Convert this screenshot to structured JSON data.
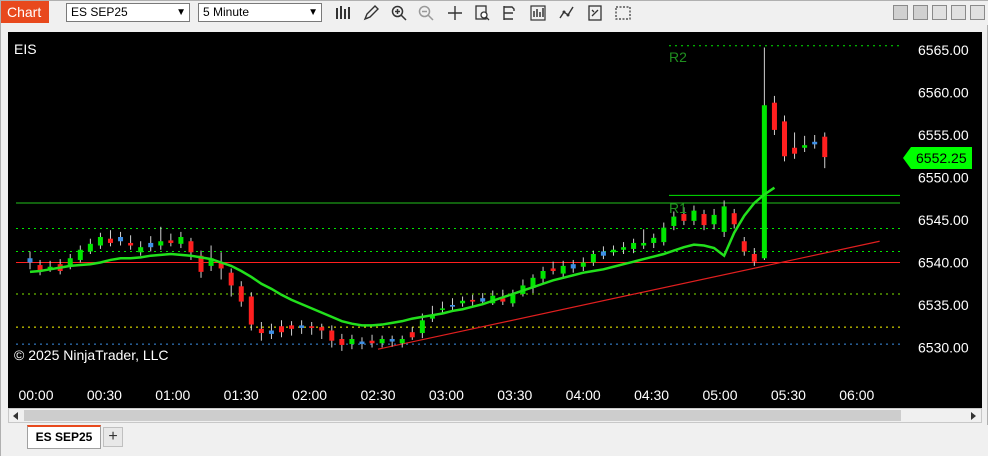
{
  "window": {
    "badge": "Chart"
  },
  "toolbar": {
    "instrument": "ES SEP25",
    "interval": "5 Minute",
    "icons": [
      "bar-style-icon",
      "pencil-icon",
      "zoom-in-icon",
      "zoom-out-icon",
      "crosshair-icon",
      "properties-icon",
      "data-box-icon",
      "indicators-icon",
      "strategies-icon",
      "templates-icon",
      "chart-trader-icon"
    ],
    "window_icons": [
      "pin-icon",
      "minimize-icon",
      "maximize-icon",
      "close-icon"
    ]
  },
  "chart": {
    "instrument_label": "EIS",
    "copyright": "© 2025 NinjaTrader, LLC",
    "price_marker": "6552.25",
    "level_labels": {
      "r2": "R2",
      "r1": "R1"
    },
    "y_ticks": [
      "6565.00",
      "6560.00",
      "6555.00",
      "6550.00",
      "6545.00",
      "6540.00",
      "6535.00",
      "6530.00"
    ],
    "x_ticks": [
      "00:00",
      "00:30",
      "01:00",
      "01:30",
      "02:00",
      "02:30",
      "03:00",
      "03:30",
      "04:00",
      "04:30",
      "05:00",
      "05:30",
      "06:00"
    ],
    "colors": {
      "up": "#00e600",
      "down": "#ff1f1f",
      "neutral": "#3d8fe6",
      "ma": "#22e01c",
      "trend": "#e01f1f"
    }
  },
  "chart_data": {
    "type": "candlestick",
    "ylim": [
      6528.5,
      6567.5
    ],
    "x_range": [
      "00:00",
      "06:00"
    ],
    "levels": [
      {
        "name": "R2",
        "value": 6565.5,
        "style": "dotted",
        "color": "#00e600"
      },
      {
        "name": "R1",
        "value": 6547.9,
        "style": "solid",
        "color": "#00e600"
      },
      {
        "value": 6547.0,
        "style": "solid",
        "color": "#22c01c"
      },
      {
        "value": 6544.0,
        "style": "dotted",
        "color": "#00e600"
      },
      {
        "value": 6541.3,
        "style": "dotted",
        "color": "#00e600"
      },
      {
        "value": 6540.0,
        "style": "solid",
        "color": "#ff1f1f"
      },
      {
        "value": 6536.3,
        "style": "dotted",
        "color": "#80e600"
      },
      {
        "value": 6532.4,
        "style": "dotted",
        "color": "#ffff00"
      },
      {
        "value": 6530.4,
        "style": "dotted",
        "color": "#3d8fe6"
      }
    ],
    "trendline": {
      "from": {
        "time": "02:30",
        "price": 6529.8
      },
      "to": {
        "time": "06:10",
        "price": 6542.5
      }
    },
    "ma": [
      [
        0,
        6538.9
      ],
      [
        1,
        6539.0
      ],
      [
        2,
        6539.2
      ],
      [
        3,
        6539.4
      ],
      [
        4,
        6539.6
      ],
      [
        5,
        6539.7
      ],
      [
        6,
        6539.8
      ],
      [
        7,
        6540.0
      ],
      [
        8,
        6540.3
      ],
      [
        9,
        6540.5
      ],
      [
        10,
        6540.5
      ],
      [
        11,
        6540.6
      ],
      [
        12,
        6540.8
      ],
      [
        13,
        6540.9
      ],
      [
        14,
        6541.0
      ],
      [
        15,
        6540.9
      ],
      [
        16,
        6540.8
      ],
      [
        17,
        6540.6
      ],
      [
        18,
        6540.4
      ],
      [
        19,
        6540.0
      ],
      [
        20,
        6539.6
      ],
      [
        21,
        6539.0
      ],
      [
        22,
        6538.3
      ],
      [
        23,
        6537.5
      ],
      [
        24,
        6536.9
      ],
      [
        25,
        6536.2
      ],
      [
        26,
        6535.6
      ],
      [
        27,
        6535.1
      ],
      [
        28,
        6534.6
      ],
      [
        29,
        6534.1
      ],
      [
        30,
        6533.6
      ],
      [
        31,
        6533.1
      ],
      [
        32,
        6532.8
      ],
      [
        33,
        6532.6
      ],
      [
        34,
        6532.6
      ],
      [
        35,
        6532.7
      ],
      [
        36,
        6532.9
      ],
      [
        37,
        6533.1
      ],
      [
        38,
        6533.4
      ],
      [
        39,
        6533.6
      ],
      [
        40,
        6533.8
      ],
      [
        41,
        6534.0
      ],
      [
        42,
        6534.3
      ],
      [
        43,
        6534.5
      ],
      [
        44,
        6534.8
      ],
      [
        45,
        6535.1
      ],
      [
        46,
        6535.5
      ],
      [
        47,
        6535.9
      ],
      [
        48,
        6536.3
      ],
      [
        49,
        6536.7
      ],
      [
        50,
        6537.1
      ],
      [
        51,
        6537.5
      ],
      [
        52,
        6537.9
      ],
      [
        53,
        6538.2
      ],
      [
        54,
        6538.5
      ],
      [
        55,
        6538.8
      ],
      [
        56,
        6539.0
      ],
      [
        57,
        6539.2
      ],
      [
        58,
        6539.5
      ],
      [
        59,
        6539.8
      ],
      [
        60,
        6540.1
      ],
      [
        61,
        6540.4
      ],
      [
        62,
        6540.7
      ],
      [
        63,
        6541.0
      ],
      [
        64,
        6541.4
      ],
      [
        65,
        6541.8
      ],
      [
        66,
        6542.1
      ],
      [
        67,
        6542.0
      ],
      [
        68,
        6541.7
      ],
      [
        69,
        6540.8
      ],
      [
        70,
        6543.5
      ],
      [
        71,
        6545.5
      ],
      [
        72,
        6547.0
      ],
      [
        73,
        6548.0
      ],
      [
        74,
        6548.8
      ]
    ],
    "candles": [
      [
        0,
        6540.5,
        6540.0,
        6541.3,
        6539.2
      ],
      [
        1,
        6539.7,
        6539.0,
        6540.3,
        6538.5
      ],
      [
        2,
        6539.2,
        6539.5,
        6540.2,
        6538.9
      ],
      [
        3,
        6539.8,
        6539.0,
        6540.4,
        6538.6
      ],
      [
        4,
        6539.5,
        6540.5,
        6541.0,
        6539.2
      ],
      [
        5,
        6540.3,
        6541.5,
        6542.0,
        6540.0
      ],
      [
        6,
        6541.3,
        6542.2,
        6542.8,
        6541.0
      ],
      [
        7,
        6542.0,
        6543.0,
        6543.5,
        6541.6
      ],
      [
        8,
        6542.8,
        6542.3,
        6543.8,
        6541.9
      ],
      [
        9,
        6542.5,
        6543.0,
        6543.6,
        6542.0
      ],
      [
        10,
        6542.3,
        6542.0,
        6543.2,
        6541.5
      ],
      [
        11,
        6541.2,
        6541.8,
        6542.5,
        6540.8
      ],
      [
        12,
        6541.8,
        6542.3,
        6543.1,
        6541.3
      ],
      [
        13,
        6542.0,
        6542.5,
        6544.2,
        6541.5
      ],
      [
        14,
        6542.6,
        6542.3,
        6543.4,
        6541.9
      ],
      [
        15,
        6542.2,
        6543.0,
        6543.6,
        6541.7
      ],
      [
        16,
        6542.5,
        6541.2,
        6542.9,
        6540.3
      ],
      [
        17,
        6540.8,
        6538.9,
        6541.4,
        6538.2
      ],
      [
        18,
        6539.6,
        6540.5,
        6542.0,
        6539.0
      ],
      [
        19,
        6540.0,
        6539.3,
        6541.2,
        6538.0
      ],
      [
        20,
        6538.8,
        6537.3,
        6539.3,
        6536.0
      ],
      [
        21,
        6537.2,
        6535.4,
        6537.8,
        6534.8
      ],
      [
        22,
        6536.0,
        6532.7,
        6536.5,
        6532.0
      ],
      [
        23,
        6532.2,
        6531.7,
        6533.0,
        6530.8
      ],
      [
        24,
        6531.6,
        6532.0,
        6532.8,
        6531.0
      ],
      [
        25,
        6532.5,
        6531.8,
        6533.2,
        6531.2
      ],
      [
        26,
        6532.6,
        6532.2,
        6533.1,
        6531.4
      ],
      [
        27,
        6532.3,
        6532.6,
        6533.2,
        6531.6
      ],
      [
        28,
        6532.5,
        6532.3,
        6533.0,
        6531.5
      ],
      [
        29,
        6532.4,
        6532.0,
        6532.8,
        6531.0
      ],
      [
        30,
        6532.0,
        6530.8,
        6532.6,
        6530.0
      ],
      [
        31,
        6531.0,
        6530.3,
        6531.6,
        6529.6
      ],
      [
        32,
        6530.4,
        6531.0,
        6531.5,
        6529.8
      ],
      [
        33,
        6530.7,
        6530.4,
        6531.2,
        6529.8
      ],
      [
        34,
        6530.8,
        6530.5,
        6531.5,
        6530.0
      ],
      [
        35,
        6530.5,
        6531.0,
        6531.4,
        6530.0
      ],
      [
        36,
        6530.7,
        6531.0,
        6531.4,
        6530.1
      ],
      [
        37,
        6530.5,
        6531.0,
        6531.4,
        6530.0
      ],
      [
        38,
        6531.8,
        6531.2,
        6532.4,
        6530.9
      ],
      [
        39,
        6531.7,
        6533.2,
        6534.0,
        6531.1
      ],
      [
        40,
        6533.4,
        6533.8,
        6534.9,
        6533.0
      ],
      [
        41,
        6534.5,
        6534.6,
        6535.4,
        6534.0
      ],
      [
        42,
        6534.8,
        6535.0,
        6535.8,
        6534.4
      ],
      [
        43,
        6535.2,
        6535.5,
        6536.0,
        6534.8
      ],
      [
        44,
        6535.6,
        6535.4,
        6536.2,
        6534.9
      ],
      [
        45,
        6535.4,
        6535.8,
        6536.4,
        6535.0
      ],
      [
        46,
        6535.2,
        6536.1,
        6536.7,
        6535.0
      ],
      [
        47,
        6535.8,
        6535.4,
        6536.8,
        6535.0
      ],
      [
        48,
        6535.2,
        6536.2,
        6536.8,
        6534.8
      ],
      [
        49,
        6536.3,
        6537.3,
        6538.0,
        6536.0
      ],
      [
        50,
        6537.0,
        6538.2,
        6538.6,
        6536.4
      ],
      [
        51,
        6538.1,
        6539.0,
        6539.5,
        6537.5
      ],
      [
        52,
        6539.3,
        6539.0,
        6540.1,
        6538.6
      ],
      [
        53,
        6538.7,
        6539.6,
        6540.2,
        6538.3
      ],
      [
        54,
        6539.8,
        6539.3,
        6540.3,
        6538.8
      ],
      [
        55,
        6539.5,
        6540.0,
        6540.6,
        6539.0
      ],
      [
        56,
        6540.0,
        6541.0,
        6541.4,
        6539.6
      ],
      [
        57,
        6540.8,
        6541.3,
        6541.9,
        6540.4
      ],
      [
        58,
        6541.2,
        6541.5,
        6542.0,
        6540.8
      ],
      [
        59,
        6541.5,
        6541.8,
        6542.4,
        6541.0
      ],
      [
        60,
        6541.6,
        6542.3,
        6542.8,
        6541.1
      ],
      [
        61,
        6542.0,
        6542.3,
        6543.9,
        6541.6
      ],
      [
        62,
        6542.3,
        6542.9,
        6543.4,
        6541.7
      ],
      [
        63,
        6542.4,
        6544.1,
        6544.7,
        6542.0
      ],
      [
        64,
        6544.3,
        6545.4,
        6546.0,
        6543.8
      ],
      [
        65,
        6545.7,
        6544.9,
        6546.5,
        6544.4
      ],
      [
        66,
        6544.9,
        6546.1,
        6546.7,
        6544.4
      ],
      [
        67,
        6545.7,
        6544.4,
        6546.2,
        6543.8
      ],
      [
        68,
        6544.5,
        6545.6,
        6546.3,
        6543.9
      ],
      [
        69,
        6543.6,
        6546.6,
        6547.3,
        6543.0
      ],
      [
        70,
        6545.8,
        6544.5,
        6546.3,
        6544.0
      ],
      [
        71,
        6542.5,
        6541.3,
        6543.0,
        6540.8
      ],
      [
        72,
        6541.0,
        6540.1,
        6541.7,
        6539.6
      ],
      [
        73,
        6540.5,
        6558.5,
        6565.3,
        6540.3
      ],
      [
        74,
        6558.8,
        6555.6,
        6559.6,
        6555.0
      ],
      [
        75,
        6556.6,
        6552.5,
        6557.3,
        6551.9
      ],
      [
        76,
        6553.5,
        6552.8,
        6555.3,
        6552.2
      ],
      [
        77,
        6553.5,
        6553.8,
        6554.9,
        6553.0
      ],
      [
        78,
        6553.9,
        6554.2,
        6555.0,
        6553.4
      ],
      [
        79,
        6554.8,
        6552.4,
        6555.3,
        6551.1
      ]
    ]
  }
}
